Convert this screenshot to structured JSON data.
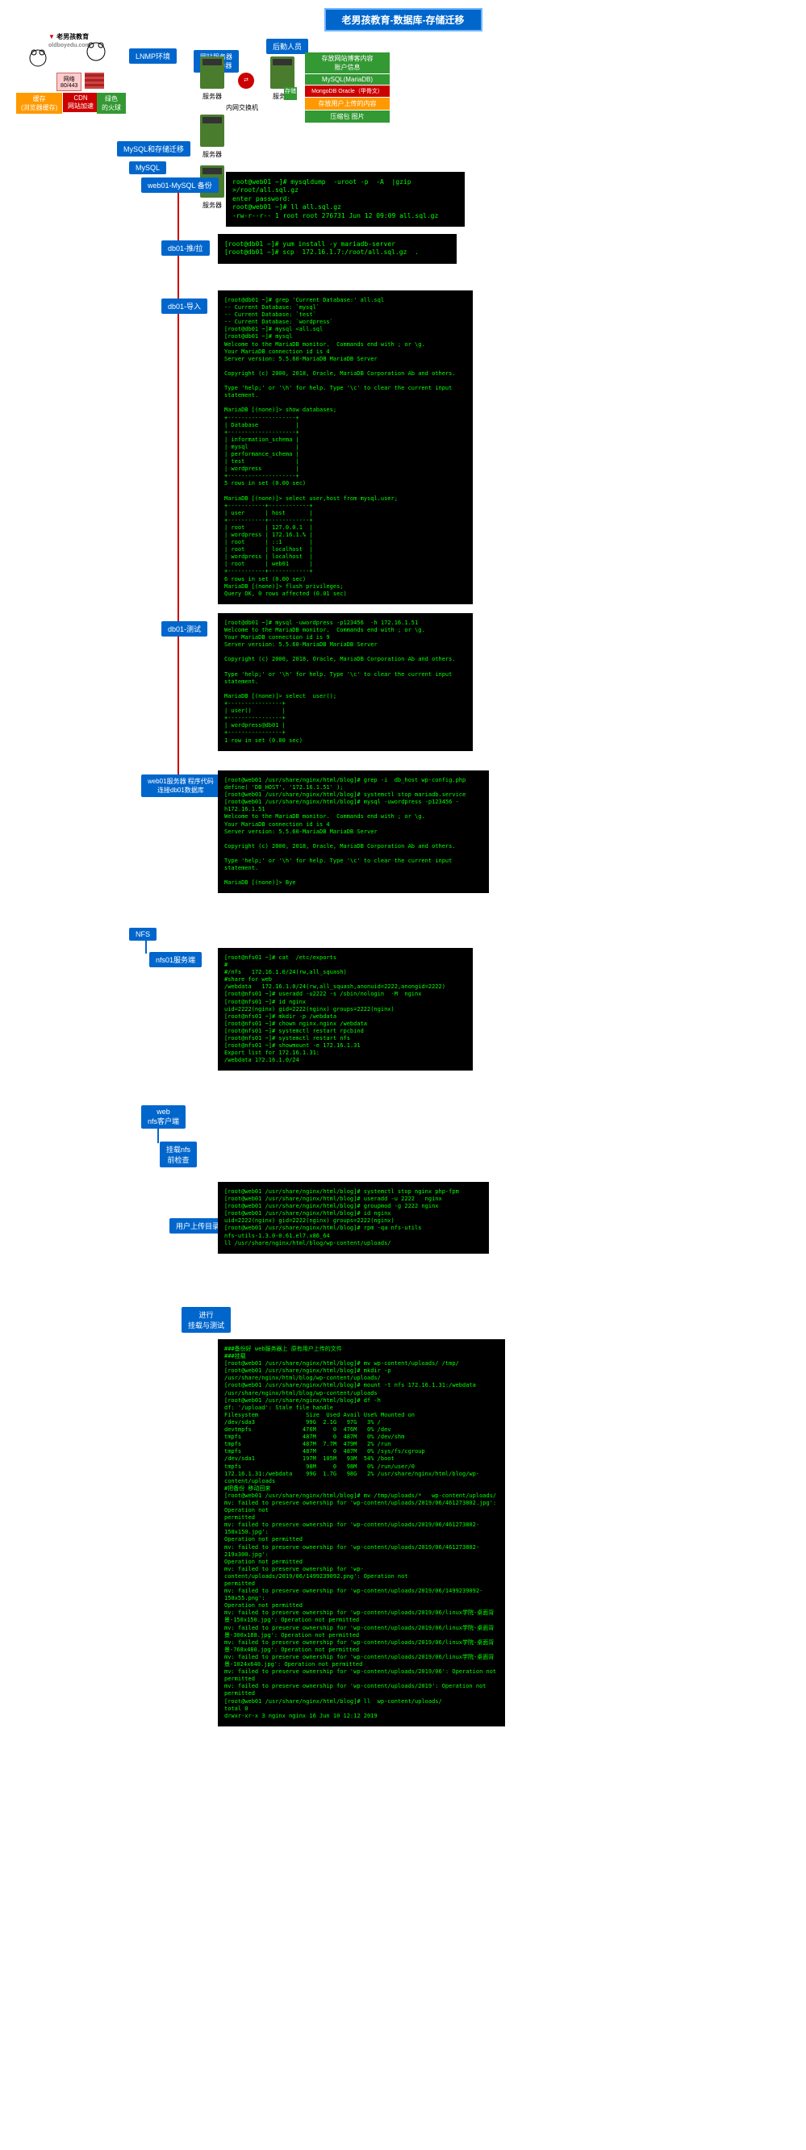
{
  "title": "老男孩教育-数据库-存储迁移",
  "logo": {
    "brand": "老男孩教育",
    "url": "oldboyedu.com"
  },
  "topology": {
    "lnmp": "LNMP环境",
    "web_server": "网站服务器\nweb服务器",
    "backend": "后勤人员",
    "cache": "缓存\n(浏览器缓存)",
    "cdn": "CDN\n网站加速",
    "net": "网络\n80/443",
    "green_dead": "绿色\n的火球",
    "switch": "内网交换机",
    "storage": "存储",
    "server_label": "服务器",
    "db_content": "存放网站博客内容\n账户信息",
    "db_mysql": "MySQL(MariaDB)",
    "db_mongo": "MongoDB Oracle（甲骨文）",
    "db_store": "存放用户上传的内容",
    "db_store2": "压缩包 图片"
  },
  "flow": {
    "mysql_migrate": "MySQL和存储迁移",
    "mysql": "MySQL",
    "web01_backup": "web01-MySQL 备份",
    "db01_pull": "db01-推/拉",
    "db01_import": "db01-导入",
    "db01_test": "db01-测试",
    "web01_conn": "web01服务器 程序代码\n连接db01数据库",
    "nfs": "NFS",
    "nfs01": "nfs01服务端",
    "web_client": "web\nnfs客户端",
    "mount_check": "挂载nfs\n前检查",
    "user_upload": "用户上传目录：",
    "mount_test": "进行\n挂载与测试"
  },
  "term1": "root@web01 ~]# mysqldump  -uroot -p  -A  |gzip  >/root/all.sql.gz\nenter password:\nroot@web01 ~]# ll all.sql.gz\n-rw-r--r-- 1 root root 276731 Jun 12 09:09 all.sql.gz",
  "term2": "[root@db01 ~]# yum install -y mariadb-server\n[root@db01 ~]# scp  172.16.1.7:/root/all.sql.gz  .",
  "term3": "[root@db01 ~]# grep 'Current Database:' all.sql\n-- Current Database: `mysql`\n-- Current Database: `test`\n-- Current Database: `wordpress`\n[root@db01 ~]# mysql <all.sql\n[root@db01 ~]# mysql\nWelcome to the MariaDB monitor.  Commands end with ; or \\g.\nYour MariaDB connection id is 4\nServer version: 5.5.60-MariaDB MariaDB Server\n\nCopyright (c) 2000, 2018, Oracle, MariaDB Corporation Ab and others.\n\nType 'help;' or '\\h' for help. Type '\\c' to clear the current input statement.\n\nMariaDB [(none)]> show databases;\n+--------------------+\n| Database           |\n+--------------------+\n| information_schema |\n| mysql              |\n| performance_schema |\n| test               |\n| wordpress          |\n+--------------------+\n5 rows in set (0.00 sec)\n\nMariaDB [(none)]> select user,host from mysql.user;\n+-----------+------------+\n| user      | host       |\n+-----------+------------+\n| root      | 127.0.0.1  |\n| wordpress | 172.16.1.% |\n| root      | ::1        |\n| root      | localhost  |\n| wordpress | localhost  |\n| root      | web01      |\n+-----------+------------+\n6 rows in set (0.00 sec)\nMariaDB [(none)]> flush privileges;\nQuery OK, 0 rows affected (0.01 sec)",
  "term4": "[root@db01 ~]# mysql -uwordpress -p123456  -h 172.16.1.51\nWelcome to the MariaDB monitor.  Commands end with ; or \\g.\nYour MariaDB connection id is 9\nServer version: 5.5.60-MariaDB MariaDB Server\n\nCopyright (c) 2000, 2018, Oracle, MariaDB Corporation Ab and others.\n\nType 'help;' or '\\h' for help. Type '\\c' to clear the current input statement.\n\nMariaDB [(none)]> select  user();\n+----------------+\n| user()         |\n+----------------+\n| wordpress@db01 |\n+----------------+\n1 row in set (0.00 sec)",
  "term5": "[root@web01 /usr/share/nginx/html/blog]# grep -i  db_host wp-config.php\ndefine( 'DB_HOST', '172.16.1.51' );\n[root@web01 /usr/share/nginx/html/blog]# systemctl stop mariadb.service\n[root@web01 /usr/share/nginx/html/blog]# mysql -uwordpress -p123456 -h172.16.1.51\nWelcome to the MariaDB monitor.  Commands end with ; or \\g.\nYour MariaDB connection id is 4\nServer version: 5.5.60-MariaDB MariaDB Server\n\nCopyright (c) 2000, 2018, Oracle, MariaDB Corporation Ab and others.\n\nType 'help;' or '\\h' for help. Type '\\c' to clear the current input statement.\n\nMariaDB [(none)]> Bye",
  "term6": "[root@nfs01 ~]# cat  /etc/exports\n#\n#/nfs   172.16.1.0/24(rw,all_squash)\n#share for web\n/webdata   172.16.1.0/24(rw,all_squash,anonuid=2222,anongid=2222)\n[root@nfs01 ~]# useradd -u2222 -s /sbin/nologin  -M  nginx\n[root@nfs01 ~]# id nginx\nuid=2222(nginx) gid=2222(nginx) groups=2222(nginx)\n[root@nfs01 ~]# mkdir -p /webdata\n[root@nfs01 ~]# chown nginx.nginx /webdata\n[root@nfs01 ~]# systemctl restart rpcbind\n[root@nfs01 ~]# systemctl restart nfs\n[root@nfs01 ~]# showmount -e 172.16.1.31\nExport list for 172.16.1.31:\n/webdata 172.16.1.0/24",
  "term7": "[root@web01 /usr/share/nginx/html/blog]# systemctl stop nginx php-fpm\n[root@web01 /usr/share/nginx/html/blog]# useradd -u 2222   nginx\n[root@web01 /usr/share/nginx/html/blog]# groupmod -g 2222 nginx\n[root@web01 /usr/share/nginx/html/blog]# id nginx\nuid=2222(nginx) gid=2222(nginx) groups=2222(nginx)\n[root@web01 /usr/share/nginx/html/blog]# rpm -qa nfs-utils\nnfs-utils-1.3.0-0.61.el7.x86_64\nll /usr/share/nginx/html/blog/wp-content/uploads/",
  "term8": "###备份好 web服务器上 原有用户上传的文件\n###挂载\n[root@web01 /usr/share/nginx/html/blog]# mv wp-content/uploads/ /tmp/\n[root@web01 /usr/share/nginx/html/blog]# mkdir -p  /usr/share/nginx/html/blog/wp-content/uploads/\n[root@web01 /usr/share/nginx/html/blog]# mount -t nfs 172.16.1.31:/webdata  \n/usr/share/nginx/html/blog/wp-content/uploads\n[root@web01 /usr/share/nginx/html/blog]# df -h\ndf: '/upload': Stale file handle\nFilesystem              Size  Used Avail Use% Mounted on\n/dev/sda3               99G  2.1G   97G   3% /\ndevtmpfs               476M     0  476M   0% /dev\ntmpfs                  487M     0  487M   0% /dev/shm\ntmpfs                  487M  7.7M  479M   2% /run\ntmpfs                  487M     0  487M   0% /sys/fs/cgroup\n/dev/sda1              197M  105M   93M  54% /boot\ntmpfs                   98M     0   98M   0% /run/user/0\n172.16.1.31:/webdata    99G  1.7G   98G   2% /usr/share/nginx/html/blog/wp-content/uploads\n#把备份 移动回来\n[root@web01 /usr/share/nginx/html/blog]# mv /tmp/uploads/*   wp-content/uploads/\nmv: failed to preserve ownership for 'wp-content/uploads/2019/06/461273802.jpg': Operation not \npermitted\nmv: failed to preserve ownership for 'wp-content/uploads/2019/06/461273802-150x150.jpg': \nOperation not permitted\nmv: failed to preserve ownership for 'wp-content/uploads/2019/06/461273802-219x300.jpg': \nOperation not permitted\nmv: failed to preserve ownership for 'wp-content/uploads/2019/06/1499239092.png': Operation not \npermitted\nmv: failed to preserve ownership for 'wp-content/uploads/2019/06/1499239092-150x55.png': \nOperation not permitted\nmv: failed to preserve ownership for 'wp-content/uploads/2019/06/linux学院-桌面背\n景-150x150.jpg': Operation not permitted\nmv: failed to preserve ownership for 'wp-content/uploads/2019/06/linux学院-桌面背\n景-300x188.jpg': Operation not permitted\nmv: failed to preserve ownership for 'wp-content/uploads/2019/06/linux学院-桌面背\n景-768x480.jpg': Operation not permitted\nmv: failed to preserve ownership for 'wp-content/uploads/2019/06/linux学院-桌面背\n景-1024x640.jpg': Operation not permitted\nmv: failed to preserve ownership for 'wp-content/uploads/2019/06': Operation not permitted\nmv: failed to preserve ownership for 'wp-content/uploads/2019': Operation not permitted\n[root@web01 /usr/share/nginx/html/blog]# ll  wp-content/uploads/\ntotal 0\ndrwxr-xr-x 3 nginx nginx 16 Jun 10 12:12 2019"
}
